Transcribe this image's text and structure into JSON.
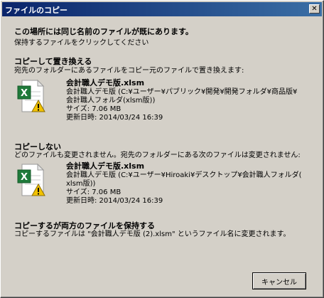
{
  "window": {
    "title": "ファイルのコピー",
    "close_glyph": "✕"
  },
  "header": {
    "main": "この場所には同じ名前のファイルが既にあります。",
    "sub": "保持するファイルをクリックしてください"
  },
  "options": {
    "replace": {
      "title": "コピーして置き換える",
      "desc": "宛先のフォルダーにあるファイルをコピー元のファイルで置き換えます:",
      "file_name": "会計職人デモ版.xlsm",
      "path_line1": "会計職人デモ版 (C:¥ユーザー¥パブリック¥開発¥開発フォルダ¥商品版¥",
      "path_line2": "会計職人フォルダ(xlsm版))",
      "size": "サイズ: 7.06 MB",
      "modified": "更新日時: 2014/03/24 16:39"
    },
    "dont_copy": {
      "title": "コピーしない",
      "desc": "どのファイルも変更されません。宛先のフォルダーにある次のファイルは変更されません:",
      "file_name": "会計職人デモ版.xlsm",
      "path_line1": "会計職人デモ版 (C:¥ユーザー¥Hiroaki¥デスクトップ¥会計職人フォルダ(",
      "path_line2": "xlsm版))",
      "size": "サイズ: 7.06 MB",
      "modified": "更新日時: 2014/03/24 16:39"
    },
    "keep_both": {
      "title": "コピーするが両方のファイルを保持する",
      "desc": "コピーするファイルは \"会計職人デモ版 (2).xlsm\" というファイル名に変更されます。"
    }
  },
  "buttons": {
    "cancel": "キャンセル"
  },
  "icons": {
    "file": "excel-file-warning-icon"
  },
  "colors": {
    "titlebar_start": "#0a246a",
    "titlebar_end": "#3a6ea5",
    "dialog_bg": "#d4d0c8",
    "excel_green": "#1f7a3a",
    "warning_yellow": "#f2c200"
  }
}
